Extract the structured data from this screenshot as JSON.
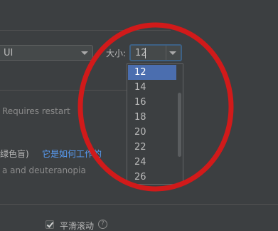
{
  "appearance": {
    "font_combo": {
      "value": "UI"
    },
    "size_label": "大小:",
    "size_combo": {
      "value": "12"
    },
    "size_options": [
      "12",
      "14",
      "16",
      "18",
      "20",
      "22",
      "24",
      "26"
    ],
    "selected_size": "12",
    "requires_restart": "Requires restart",
    "color_blind_label": "绿色盲)",
    "how_it_works_link": "它是如何工作的",
    "color_blind_note": "a and deuteranopia",
    "smooth_scrolling": {
      "label": "平滑滚动",
      "checked": true
    }
  },
  "annotation_color": "#d11a1a"
}
